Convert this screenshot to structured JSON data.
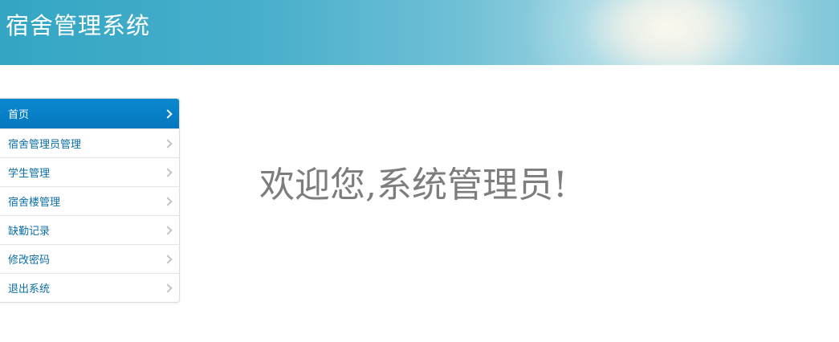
{
  "header": {
    "title": "宿舍管理系统"
  },
  "sidebar": {
    "items": [
      {
        "label": "首页",
        "active": true,
        "icon": "chevron-right-icon"
      },
      {
        "label": "宿舍管理员管理",
        "active": false,
        "icon": "chevron-right-icon"
      },
      {
        "label": "学生管理",
        "active": false,
        "icon": "chevron-right-icon"
      },
      {
        "label": "宿舍楼管理",
        "active": false,
        "icon": "chevron-right-icon"
      },
      {
        "label": "缺勤记录",
        "active": false,
        "icon": "chevron-right-icon"
      },
      {
        "label": "修改密码",
        "active": false,
        "icon": "chevron-right-icon"
      },
      {
        "label": "退出系统",
        "active": false,
        "icon": "chevron-right-icon"
      }
    ]
  },
  "main": {
    "welcome": "欢迎您,系统管理员!"
  },
  "colors": {
    "header_gradient_start": "#33a6c4",
    "active_item_bg": "#0781c8",
    "link_text": "#0b6fa8",
    "welcome_text": "#7d7d7d"
  }
}
